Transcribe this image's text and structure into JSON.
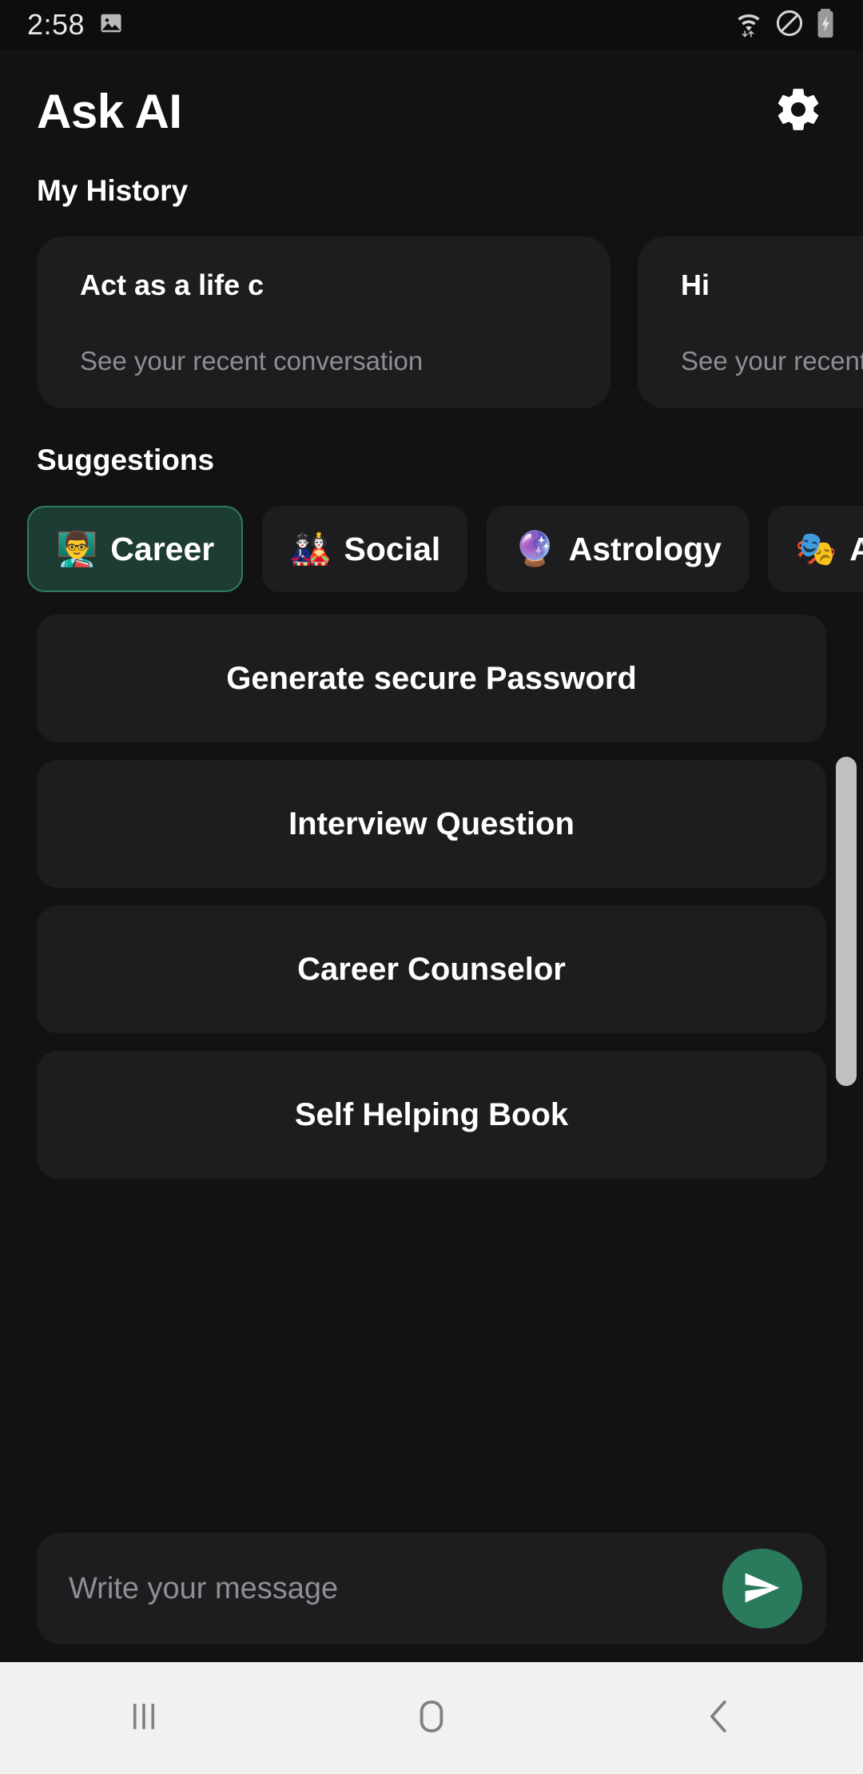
{
  "status_bar": {
    "time": "2:58",
    "left_icons": [
      {
        "name": "image-icon"
      }
    ],
    "right_icons": [
      {
        "name": "wifi-icon"
      },
      {
        "name": "do-not-disturb-icon"
      },
      {
        "name": "battery-charging-icon"
      }
    ]
  },
  "header": {
    "title": "Ask AI",
    "settings_icon": "gear-icon"
  },
  "history": {
    "section_title": "My History",
    "cards": [
      {
        "title": "Act as a life c",
        "subtitle": "See your recent conversation"
      },
      {
        "title": "Hi",
        "subtitle": "See your recent conversation"
      }
    ]
  },
  "suggestions": {
    "section_title": "Suggestions",
    "categories": [
      {
        "label": "Career",
        "emoji": "👨‍🏫",
        "selected": true
      },
      {
        "label": "Social",
        "emoji": "🎎",
        "selected": false
      },
      {
        "label": "Astrology",
        "emoji": "🔮",
        "selected": false
      },
      {
        "label": "A",
        "emoji": "🎭",
        "selected": false
      }
    ],
    "items": [
      "Generate secure Password",
      "Interview Question",
      "Career Counselor",
      "Self Helping Book"
    ]
  },
  "composer": {
    "placeholder": "Write your message",
    "value": "",
    "send_icon": "send-icon",
    "send_color": "#2a7a5c"
  },
  "nav_bar": {
    "buttons": [
      {
        "name": "recents-icon"
      },
      {
        "name": "home-icon"
      },
      {
        "name": "back-icon"
      }
    ]
  },
  "colors": {
    "background": "#121212",
    "card": "#1d1d1f",
    "accent": "#2a7a5c",
    "selected_chip_bg": "#1d3c33",
    "selected_chip_border": "#2e7d5f",
    "muted_text": "#8e8e93"
  }
}
